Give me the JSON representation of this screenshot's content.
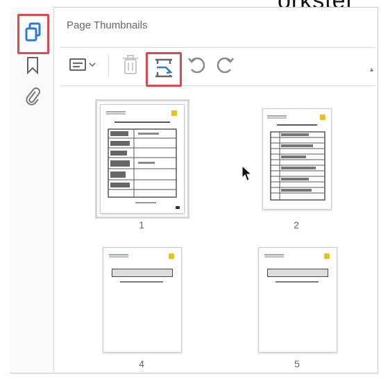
{
  "overflow_text": "orkstel",
  "panel": {
    "title": "Page Thumbnails"
  },
  "rail": {
    "items": [
      "page-thumbnails-icon",
      "bookmark-icon",
      "attachment-icon"
    ]
  },
  "toolbar": {
    "items": [
      "thumbnail-options-icon",
      "delete-page-icon",
      "insert-pages-icon",
      "rotate-counterclockwise-icon",
      "rotate-clockwise-icon"
    ]
  },
  "thumbnails": [
    {
      "page": "1",
      "selected": true
    },
    {
      "page": "2",
      "selected": false
    },
    {
      "page": "4",
      "selected": false
    },
    {
      "page": "5",
      "selected": false
    }
  ],
  "colors": {
    "highlight": "#e0484f",
    "active_icon": "#2a7bd6",
    "logo": "#e8c21a"
  }
}
